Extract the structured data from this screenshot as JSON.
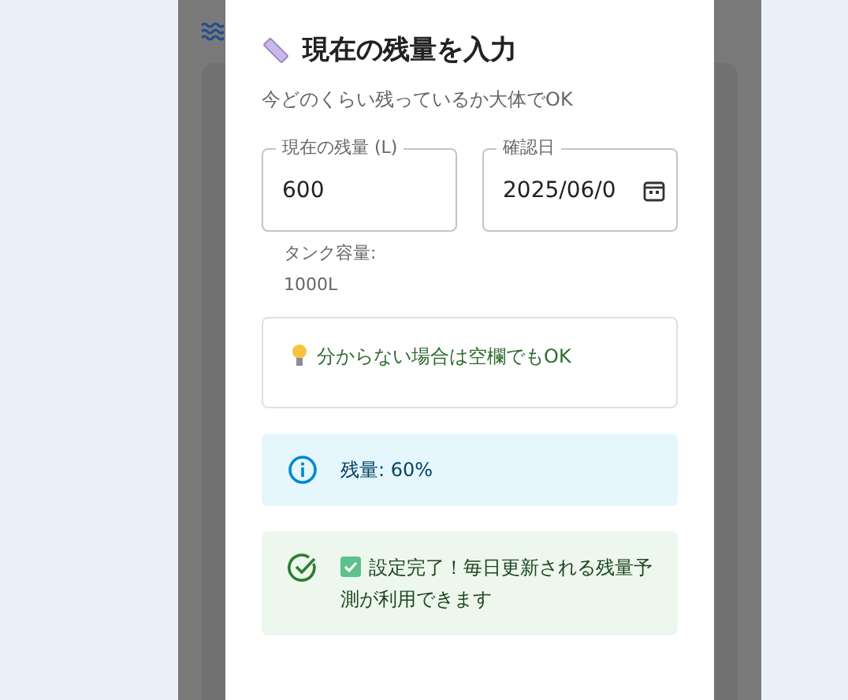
{
  "dialog": {
    "title": "現在の残量を入力",
    "subtitle": "今どのくらい残っているか大体でOK",
    "fields": [
      {
        "kind": "number",
        "label": "現在の残量 (L)",
        "value": "600",
        "helper": "タンク容量: 1000L"
      },
      {
        "kind": "date",
        "label": "確認日",
        "value": "2025/06/0"
      }
    ],
    "tip": "分からない場合は空欄でもOK",
    "alerts": [
      {
        "kind": "info",
        "text": "残量: 60%"
      },
      {
        "kind": "success",
        "text": "設定完了！毎日更新される残量予測が利用できます"
      }
    ]
  }
}
